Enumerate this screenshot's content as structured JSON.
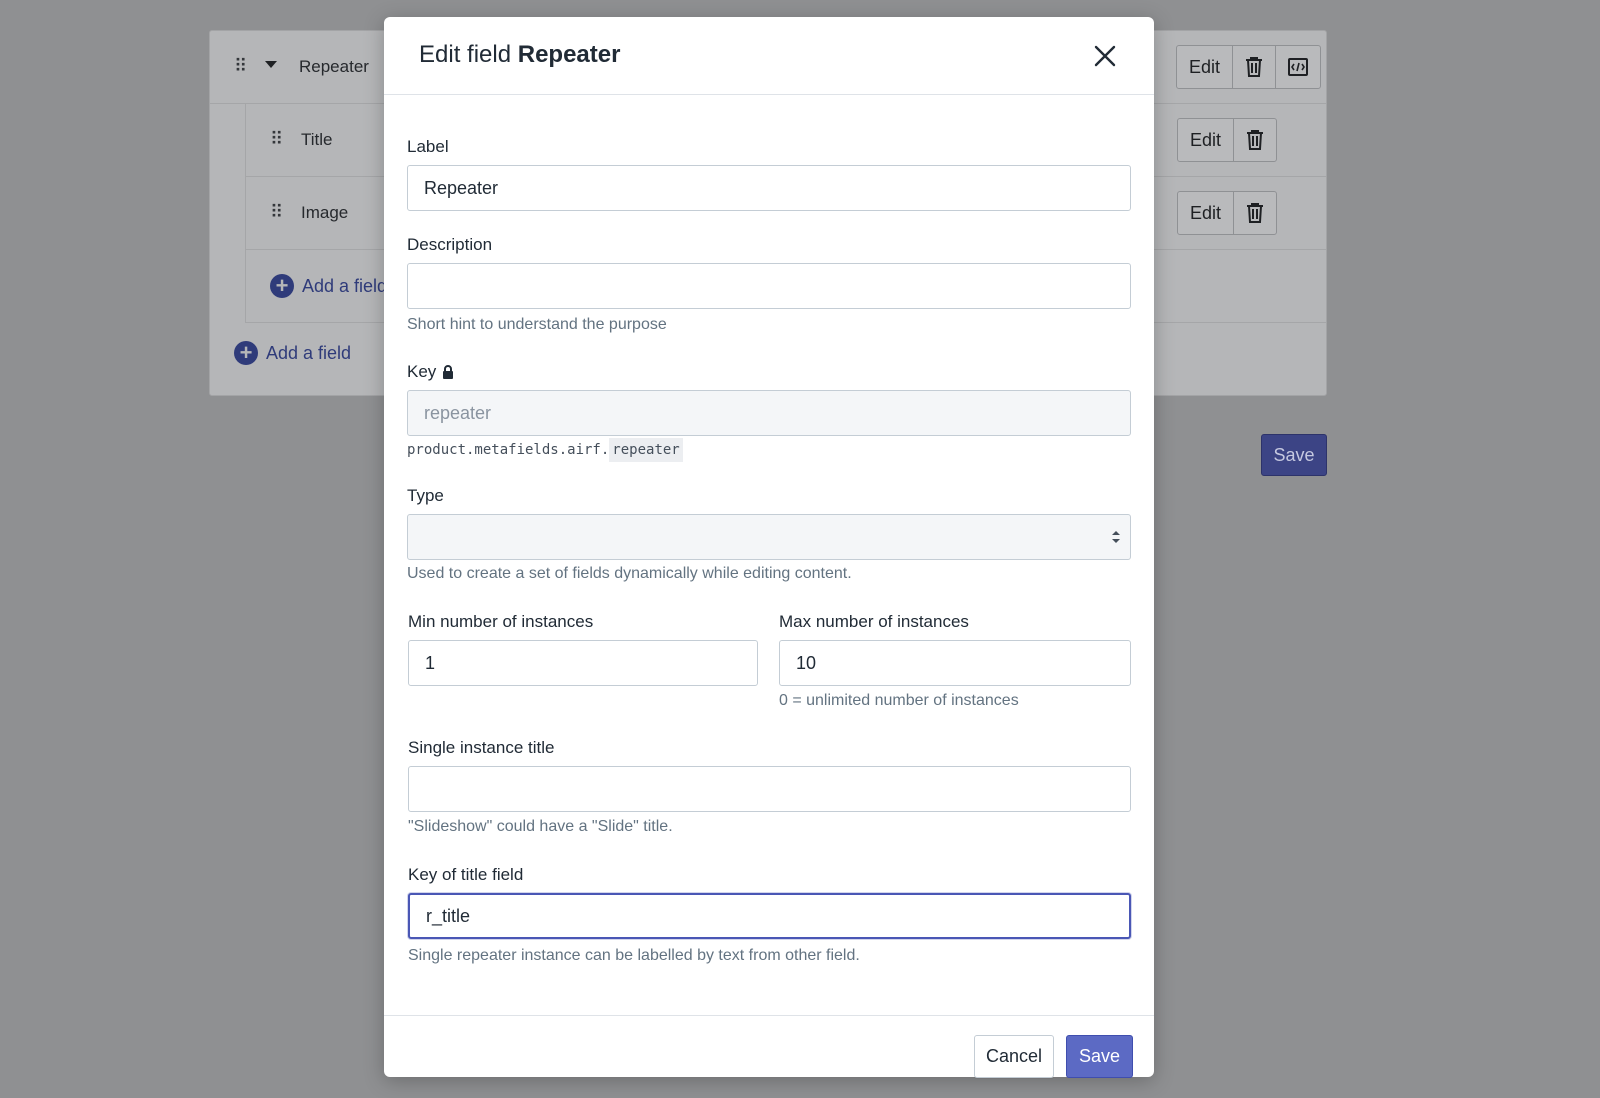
{
  "background": {
    "rows": [
      {
        "label": "Repeater",
        "actions": [
          "Edit"
        ]
      },
      {
        "label": "Title",
        "actions": [
          "Edit"
        ]
      },
      {
        "label": "Image",
        "actions": [
          "Edit"
        ]
      }
    ],
    "add_field_nested": "Add a field",
    "add_field": "Add a field",
    "save_label": "Save"
  },
  "modal": {
    "title_prefix": "Edit field",
    "title_name": "Repeater",
    "label": {
      "label": "Label",
      "value": "Repeater"
    },
    "description": {
      "label": "Description",
      "value": "",
      "hint": "Short hint to understand the purpose"
    },
    "key": {
      "label": "Key",
      "placeholder": "repeater",
      "code_prefix": "product.metafields.airf.",
      "code_key": "repeater"
    },
    "type": {
      "label": "Type",
      "value": "",
      "hint": "Used to create a set of fields dynamically while editing content."
    },
    "min_instances": {
      "label": "Min number of instances",
      "value": "1"
    },
    "max_instances": {
      "label": "Max number of instances",
      "value": "10",
      "hint": "0 = unlimited number of instances"
    },
    "single_title": {
      "label": "Single instance title",
      "value": "",
      "hint": "\"Slideshow\" could have a \"Slide\" title."
    },
    "title_key": {
      "label": "Key of title field",
      "value": "r_title",
      "hint": "Single repeater instance can be labelled by text from other field."
    },
    "cancel_label": "Cancel",
    "save_label": "Save"
  },
  "colors": {
    "primary": "#5c6ac4",
    "overlay": "#8f9092"
  }
}
